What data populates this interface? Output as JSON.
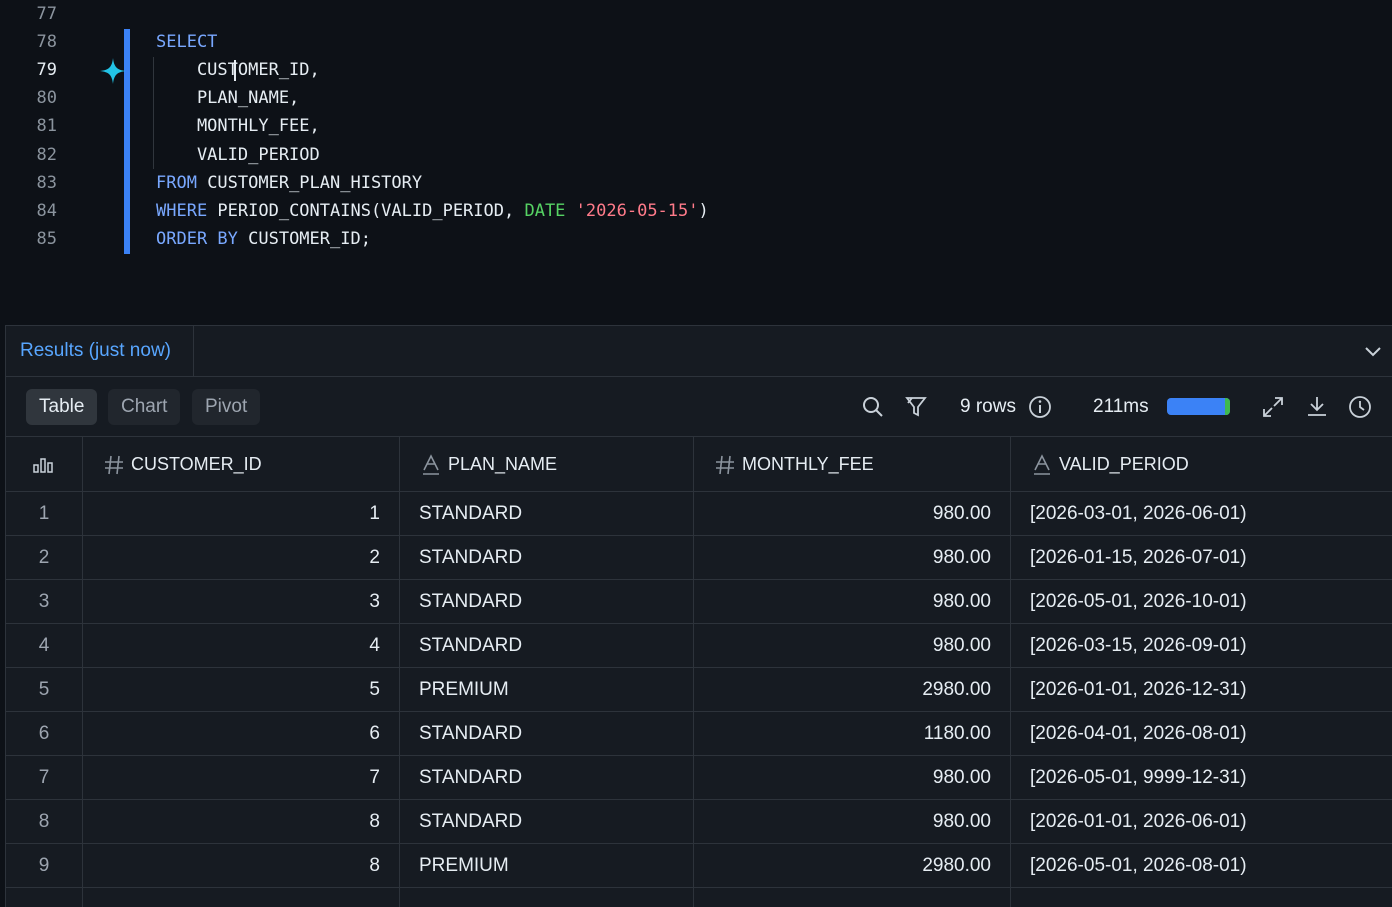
{
  "editor": {
    "lines": [
      {
        "num": "77"
      },
      {
        "num": "78"
      },
      {
        "num": "79"
      },
      {
        "num": "80"
      },
      {
        "num": "81"
      },
      {
        "num": "82"
      },
      {
        "num": "83"
      },
      {
        "num": "84"
      },
      {
        "num": "85"
      }
    ],
    "code": {
      "l78_kw": "SELECT",
      "l79": "    CUSTOMER_ID,",
      "l80": "    PLAN_NAME,",
      "l81": "    MONTHLY_FEE,",
      "l82": "    VALID_PERIOD",
      "l83_kw": "FROM",
      "l83_rest": " CUSTOMER_PLAN_HISTORY",
      "l84_kw": "WHERE",
      "l84_mid": " PERIOD_CONTAINS(VALID_PERIOD, ",
      "l84_date": "DATE",
      "l84_sp": " ",
      "l84_str": "'2026-05-15'",
      "l84_end": ")",
      "l85_kw": "ORDER BY",
      "l85_rest": " CUSTOMER_ID;"
    },
    "colors": {
      "keyword": "#79a8ff",
      "date_keyword": "#56d364",
      "string": "#ff7b8a",
      "accent_bar": "#3b82f6"
    }
  },
  "results": {
    "tab_label": "Results (just now)",
    "view_tabs": [
      "Table",
      "Chart",
      "Pivot"
    ],
    "active_view": "Table",
    "row_count": "9 rows",
    "duration": "211ms",
    "progress_fraction": 1.0,
    "icons": [
      "search-icon",
      "filter-icon",
      "info-icon",
      "expand-icon",
      "download-icon",
      "history-icon",
      "chevron-down-icon",
      "column-stats-icon"
    ]
  },
  "table": {
    "columns": [
      {
        "name": "CUSTOMER_ID",
        "type": "number"
      },
      {
        "name": "PLAN_NAME",
        "type": "text"
      },
      {
        "name": "MONTHLY_FEE",
        "type": "number"
      },
      {
        "name": "VALID_PERIOD",
        "type": "text"
      }
    ],
    "rows": [
      {
        "rn": "1",
        "customer_id": "1",
        "plan_name": "STANDARD",
        "monthly_fee": "980.00",
        "valid_period": "[2026-03-01, 2026-06-01)"
      },
      {
        "rn": "2",
        "customer_id": "2",
        "plan_name": "STANDARD",
        "monthly_fee": "980.00",
        "valid_period": "[2026-01-15, 2026-07-01)"
      },
      {
        "rn": "3",
        "customer_id": "3",
        "plan_name": "STANDARD",
        "monthly_fee": "980.00",
        "valid_period": "[2026-05-01, 2026-10-01)"
      },
      {
        "rn": "4",
        "customer_id": "4",
        "plan_name": "STANDARD",
        "monthly_fee": "980.00",
        "valid_period": "[2026-03-15, 2026-09-01)"
      },
      {
        "rn": "5",
        "customer_id": "5",
        "plan_name": "PREMIUM",
        "monthly_fee": "2980.00",
        "valid_period": "[2026-01-01, 2026-12-31)"
      },
      {
        "rn": "6",
        "customer_id": "6",
        "plan_name": "STANDARD",
        "monthly_fee": "1180.00",
        "valid_period": "[2026-04-01, 2026-08-01)"
      },
      {
        "rn": "7",
        "customer_id": "7",
        "plan_name": "STANDARD",
        "monthly_fee": "980.00",
        "valid_period": "[2026-05-01, 9999-12-31)"
      },
      {
        "rn": "8",
        "customer_id": "8",
        "plan_name": "STANDARD",
        "monthly_fee": "980.00",
        "valid_period": "[2026-01-01, 2026-06-01)"
      },
      {
        "rn": "9",
        "customer_id": "8",
        "plan_name": "PREMIUM",
        "monthly_fee": "2980.00",
        "valid_period": "[2026-05-01, 2026-08-01)"
      }
    ]
  }
}
